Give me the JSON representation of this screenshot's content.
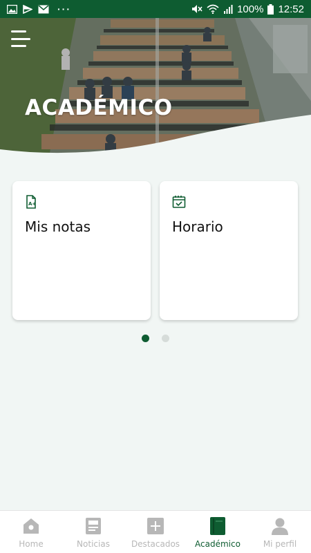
{
  "status_bar": {
    "battery_percent": "100%",
    "time": "12:52",
    "icons": [
      "image-icon",
      "play-icon",
      "mail-icon",
      "more-dots-icon",
      "mute-icon",
      "wifi-icon",
      "signal-icon",
      "battery-icon"
    ]
  },
  "hero": {
    "title": "ACADÉMICO",
    "menu_icon": "hamburger-menu-icon"
  },
  "cards": [
    {
      "label": "Mis notas",
      "icon": "grade-document-icon"
    },
    {
      "label": "Horario",
      "icon": "calendar-check-icon"
    }
  ],
  "pager": {
    "total": 2,
    "active": 1
  },
  "bottom_nav": {
    "items": [
      {
        "label": "Home",
        "icon": "home-icon"
      },
      {
        "label": "Noticias",
        "icon": "news-icon"
      },
      {
        "label": "Destacados",
        "icon": "plus-box-icon"
      },
      {
        "label": "Académico",
        "icon": "book-icon"
      },
      {
        "label": "Mi perfil",
        "icon": "person-icon"
      }
    ],
    "active_index": 3
  },
  "colors": {
    "brand": "#0e5c31",
    "background": "#f1f6f4",
    "inactive": "#b7b7b7"
  }
}
